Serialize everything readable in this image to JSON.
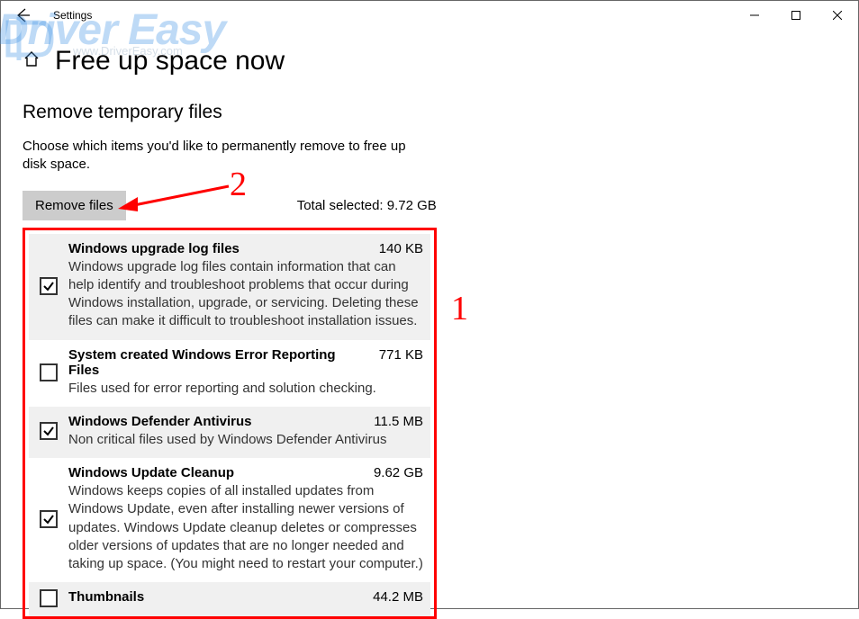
{
  "window": {
    "app_title": "Settings"
  },
  "page": {
    "title": "Free up space now",
    "section_heading": "Remove temporary files",
    "description": "Choose which items you'd like to permanently remove to free up disk space.",
    "remove_button": "Remove files",
    "total_selected_label": "Total selected: 9.72 GB"
  },
  "items": [
    {
      "title": "Windows upgrade log files",
      "size": "140 KB",
      "desc": "Windows upgrade log files contain information that can help identify and troubleshoot problems that occur during Windows installation, upgrade, or servicing.  Deleting these files can make it difficult to troubleshoot installation issues.",
      "checked": true
    },
    {
      "title": "System created Windows Error Reporting Files",
      "size": "771 KB",
      "desc": "Files used for error reporting and solution checking.",
      "checked": false
    },
    {
      "title": "Windows Defender Antivirus",
      "size": "11.5 MB",
      "desc": "Non critical files used by Windows Defender Antivirus",
      "checked": true
    },
    {
      "title": "Windows Update Cleanup",
      "size": "9.62 GB",
      "desc": "Windows keeps copies of all installed updates from Windows Update, even after installing newer versions of updates. Windows Update cleanup deletes or compresses older versions of updates that are no longer needed and taking up space. (You might need to restart your computer.)",
      "checked": true
    },
    {
      "title": "Thumbnails",
      "size": "44.2 MB",
      "desc": "",
      "checked": false
    }
  ],
  "annotations": {
    "label1": "1",
    "label2": "2"
  },
  "watermark": {
    "text": "Driver Easy",
    "sub": "www.DriverEasy.com"
  }
}
